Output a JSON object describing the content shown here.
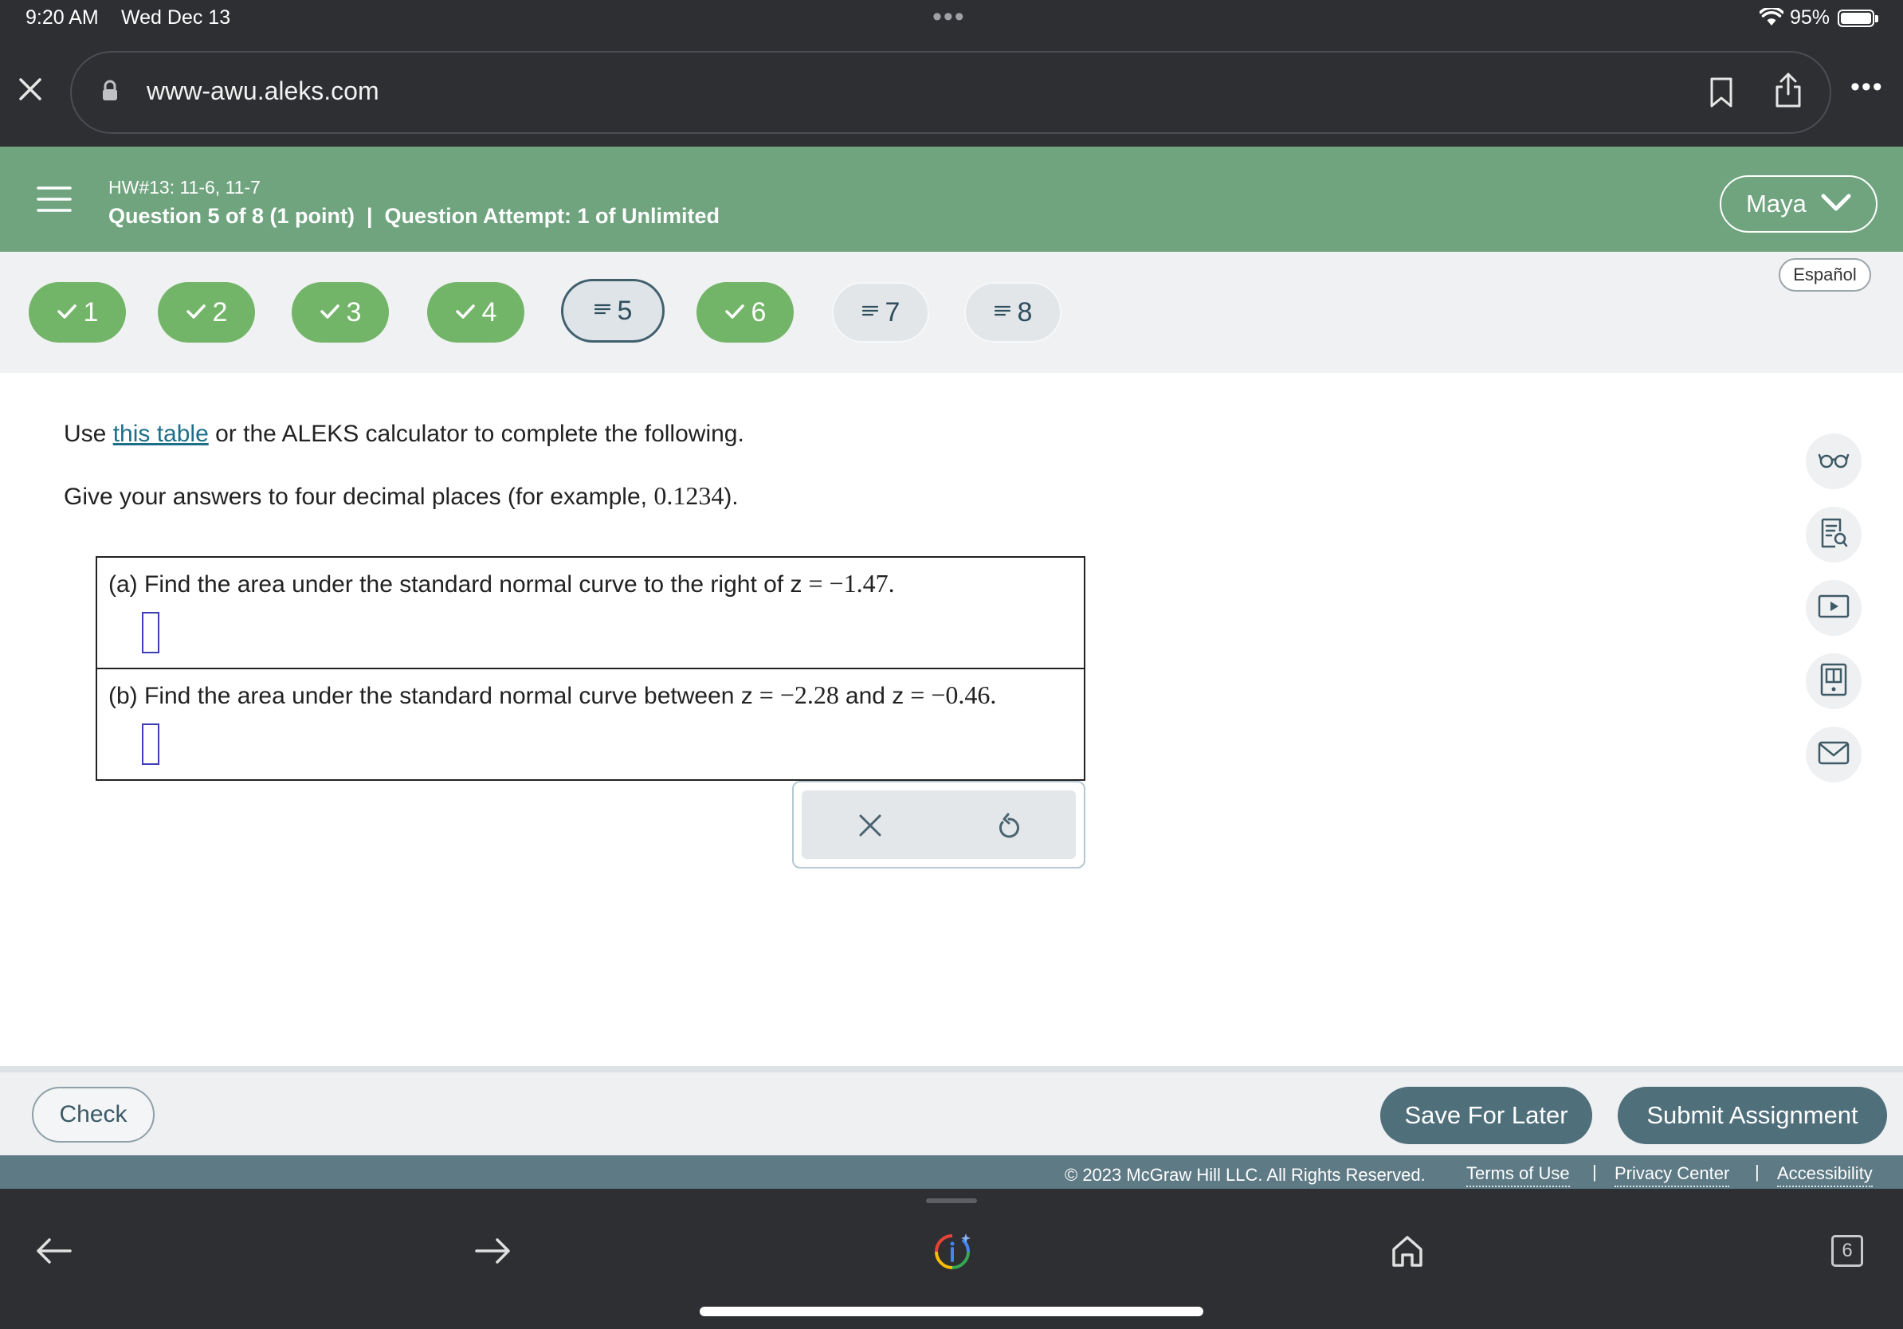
{
  "status_bar": {
    "time": "9:20 AM",
    "date": "Wed Dec 13",
    "multitask_dots": "•••",
    "battery": "95%"
  },
  "browser": {
    "url": "www-awu.aleks.com",
    "more": "•••"
  },
  "header": {
    "assignment": "HW#13: 11-6, 11-7",
    "question_info": "Question 5 of 8 (1 point)  |  Question Attempt: 1 of Unlimited",
    "user": "Maya"
  },
  "nav": {
    "questions": [
      {
        "label": "1",
        "state": "done"
      },
      {
        "label": "2",
        "state": "done"
      },
      {
        "label": "3",
        "state": "done"
      },
      {
        "label": "4",
        "state": "done"
      },
      {
        "label": "5",
        "state": "current"
      },
      {
        "label": "6",
        "state": "done"
      },
      {
        "label": "7",
        "state": "todo"
      },
      {
        "label": "8",
        "state": "todo"
      }
    ],
    "language": "Español"
  },
  "content": {
    "intro_prefix": "Use ",
    "intro_link": "this table",
    "intro_suffix": " or the ALEKS calculator to complete the following.",
    "instruction_prefix": "Give your answers to four decimal places (for example, ",
    "instruction_example": "0.1234",
    "instruction_suffix": ").",
    "part_a_text": "(a) Find the area under the standard normal curve to the right of z",
    "part_a_math": " = −1.47.",
    "part_b_text": "(b) Find the area under the standard normal curve between z",
    "part_b_math1": " = −2.28 ",
    "part_b_and": "and z",
    "part_b_math2": " = −0.46."
  },
  "footer": {
    "check": "Check",
    "save": "Save For Later",
    "submit": "Submit Assignment",
    "copyright": "© 2023 McGraw Hill LLC. All Rights Reserved.",
    "terms": "Terms of Use",
    "privacy": "Privacy Center",
    "accessibility": "Accessibility",
    "separator": "|"
  },
  "bottom_bar": {
    "tab_count": "6"
  },
  "colors": {
    "header_green": "#6fa47f",
    "done_green": "#73b568",
    "primary_button": "#4f6f7b",
    "link": "#1c6f8a"
  }
}
